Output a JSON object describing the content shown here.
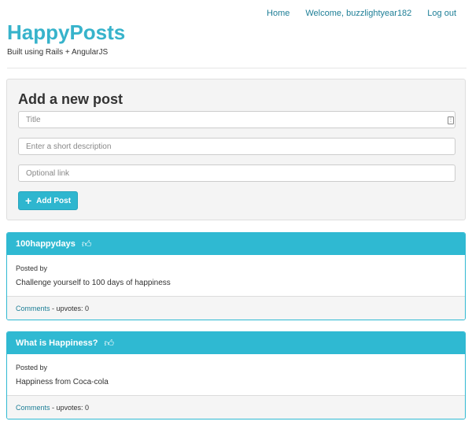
{
  "nav": {
    "home": "Home",
    "welcome": "Welcome, buzzlightyear182",
    "logout": "Log out"
  },
  "brand": {
    "title": "HappyPosts",
    "subtitle": "Built using Rails + AngularJS"
  },
  "form": {
    "heading": "Add a new post",
    "title_placeholder": "Title",
    "description_placeholder": "Enter a short description",
    "link_placeholder": "Optional link",
    "submit_label": "Add Post",
    "submit_icon": "plus-icon"
  },
  "posts": [
    {
      "title": "100happydays",
      "posted_by": "Posted by",
      "description": "Challenge yourself to 100 days of happiness",
      "comments_label": "Comments",
      "upvotes_text": " - upvotes: 0",
      "icon": "thumbs-up-icon"
    },
    {
      "title": "What is Happiness?",
      "posted_by": "Posted by",
      "description": "Happiness from Coca-cola",
      "comments_label": "Comments",
      "upvotes_text": " - upvotes: 0",
      "icon": "thumbs-up-icon"
    }
  ],
  "colors": {
    "accent": "#2fb9d2",
    "brand": "#37b3cb",
    "link": "#1d7e96",
    "panel": "#f4f4f4"
  }
}
